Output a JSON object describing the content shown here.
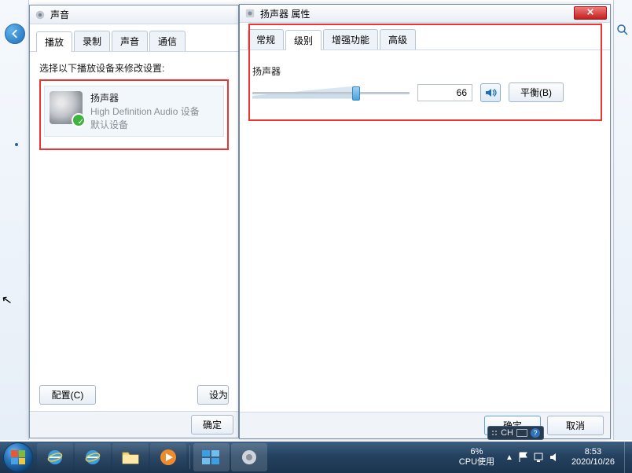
{
  "sound_dialog": {
    "title": "声音",
    "tabs": [
      "播放",
      "录制",
      "声音",
      "通信"
    ],
    "active_tab": 0,
    "instruction": "选择以下播放设备来修改设置:",
    "device": {
      "name": "扬声器",
      "subtitle": "High Definition Audio 设备",
      "status": "默认设备"
    },
    "configure_btn": "配置(C)",
    "setdefault_btn_partial": "设为",
    "ok_btn_partial": "确定"
  },
  "prop_dialog": {
    "title": "扬声器 属性",
    "tabs": [
      "常规",
      "级别",
      "增强功能",
      "高级"
    ],
    "active_tab": 1,
    "section_label": "扬声器",
    "level_value": "66",
    "balance_btn": "平衡(B)",
    "ok_btn": "确定",
    "cancel_btn": "取消"
  },
  "taskbar": {
    "usage_pct": "6%",
    "usage_label": "CPU使用",
    "time": "8:53",
    "date": "2020/10/26",
    "lang": "CH"
  }
}
